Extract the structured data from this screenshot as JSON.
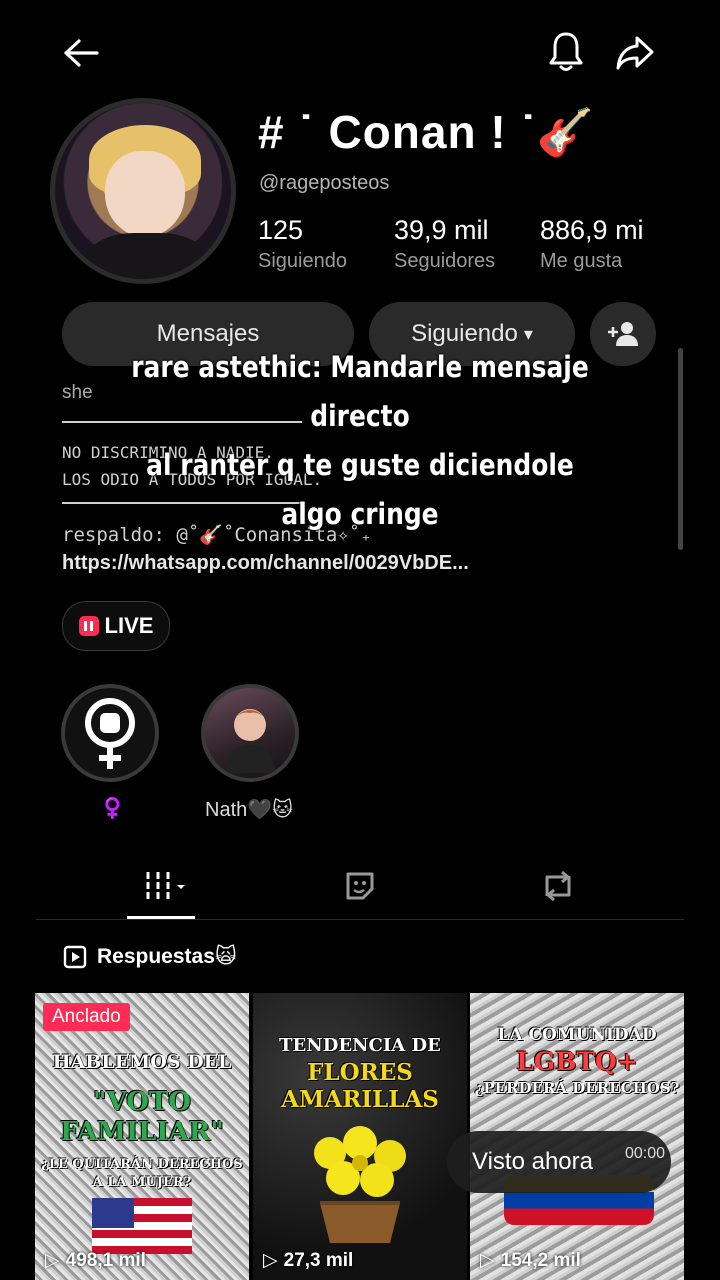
{
  "profile": {
    "display_name": "# ˙ Conan ! ˙🎸",
    "username": "@rageposteos",
    "stats": [
      {
        "value": "125",
        "label": "Siguiendo"
      },
      {
        "value": "39,9 mil",
        "label": "Seguidores"
      },
      {
        "value": "886,9 mi",
        "label": "Me gusta"
      }
    ]
  },
  "actions": {
    "messages": "Mensajes",
    "following": "Siguiendo",
    "following_caret": "▾"
  },
  "bio": {
    "pronoun": "she",
    "line1": "NO DISCRIMINO A NADIE.",
    "line2": "LOS ODIO A TODOS POR IGUAL.",
    "backup": "respaldo: @˚🎸˚Conansita✧˚₊",
    "link": "https://whatsapp.com/channel/0029VbDE..."
  },
  "overlay_caption": {
    "line1": "rare astethic: Mandarle mensaje directo",
    "line2": "al ranter q te guste diciendole",
    "line3": "algo cringe"
  },
  "live": {
    "label": "LIVE"
  },
  "highlights": [
    {
      "label": "♀️"
    },
    {
      "label": "Nath🖤🐱"
    }
  ],
  "section": {
    "label": "Respuestas🙀"
  },
  "videos": [
    {
      "badge": "Anclado",
      "title_lines": [
        "HABLEMOS DEL",
        "\"VOTO",
        "FAMILIAR\"",
        "¿LE QUITARÁN DERECHOS",
        "A LA MUJER?"
      ],
      "views": "498,1 mil"
    },
    {
      "title_lines": [
        "TENDENCIA DE",
        "FLORES",
        "AMARILLAS"
      ],
      "views": "27,3 mil"
    },
    {
      "title_lines": [
        "LA COMUNIDAD",
        "LGBTQ+",
        "¿PERDERÁ DERECHOS?"
      ],
      "views": "154,2 mil",
      "watched_label": "Visto ahora",
      "time": "00:00"
    }
  ],
  "colors": {
    "accent_red": "#fe2c55",
    "chip_bg": "#2a2a2a"
  }
}
